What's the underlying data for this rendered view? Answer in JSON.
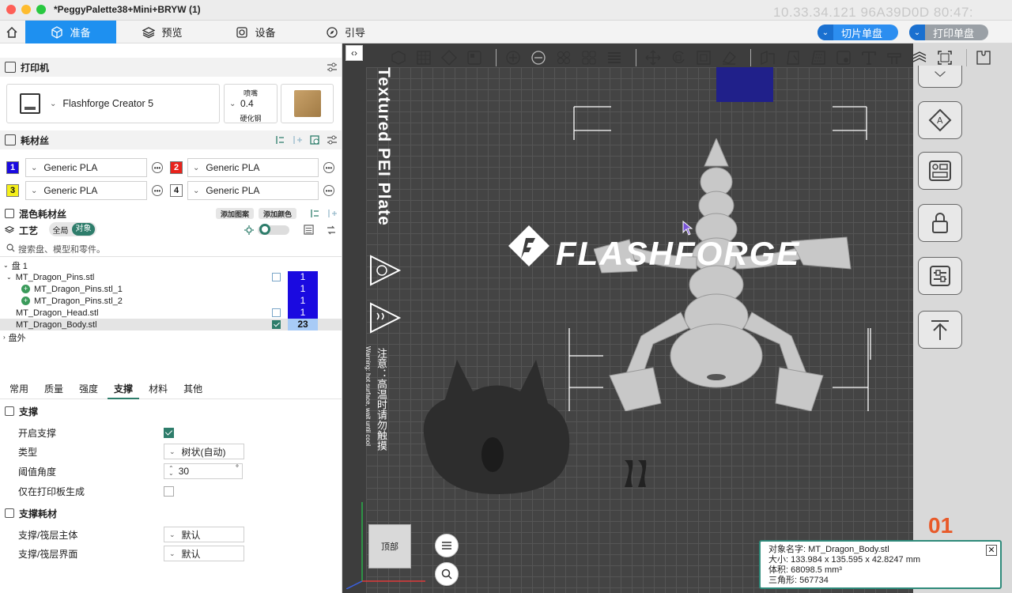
{
  "window": {
    "title": "*PeggyPalette38+Mini+BRYW (1)",
    "ip_watermark": "10.33.34.121  96A39D0D  80:47:"
  },
  "tabs": [
    {
      "label": "准备",
      "icon": "cube-icon",
      "active": true
    },
    {
      "label": "预览",
      "icon": "layers-icon",
      "active": false
    },
    {
      "label": "设备",
      "icon": "device-icon",
      "active": false
    },
    {
      "label": "引导",
      "icon": "compass-icon",
      "active": false
    }
  ],
  "actions": {
    "slice_label": "切片单盘",
    "print_label": "打印单盘"
  },
  "printer": {
    "section_title": "打印机",
    "name": "Flashforge Creator 5",
    "nozzle_label": "喷嘴",
    "nozzle_value": "0.4",
    "nozzle_material": "硬化钢"
  },
  "filament": {
    "section_title": "耗材丝",
    "slots": [
      {
        "index": "1",
        "name": "Generic PLA",
        "color": "#1a0ae0",
        "text_color": "#ffffff"
      },
      {
        "index": "2",
        "name": "Generic PLA",
        "color": "#e8231c",
        "text_color": "#ffffff"
      },
      {
        "index": "3",
        "name": "Generic PLA",
        "color": "#f5f01a",
        "text_color": "#111111"
      },
      {
        "index": "4",
        "name": "Generic PLA",
        "color": "#ffffff",
        "text_color": "#111111"
      }
    ]
  },
  "mixed": {
    "title": "混色耗材丝",
    "add_pattern": "添加图案",
    "add_color": "添加颜色"
  },
  "process": {
    "title": "工艺",
    "toggle_global": "全局",
    "toggle_object": "对象"
  },
  "search": {
    "placeholder": "搜索盘、模型和零件。"
  },
  "tree": {
    "plate": "盘 1",
    "items": [
      {
        "name": "MT_Dragon_Pins.stl",
        "index": "1"
      },
      {
        "name": "MT_Dragon_Pins.stl_1",
        "index": "1"
      },
      {
        "name": "MT_Dragon_Pins.stl_2",
        "index": "1"
      },
      {
        "name": "MT_Dragon_Head.stl",
        "index": "1"
      },
      {
        "name": "MT_Dragon_Body.stl",
        "index": "23"
      }
    ],
    "outside": "盘外"
  },
  "prop_tabs": [
    "常用",
    "质量",
    "强度",
    "支撑",
    "材料",
    "其他"
  ],
  "support": {
    "heading": "支撑",
    "enable_label": "开启支撑",
    "type_label": "类型",
    "type_value": "树状(自动)",
    "threshold_label": "阈值角度",
    "threshold_value": "30",
    "threshold_unit": "°",
    "buildplate_only_label": "仅在打印板生成",
    "filament_heading": "支撑耗材",
    "base_label": "支撑/筏层主体",
    "base_value": "默认",
    "interface_label": "支撑/筏层界面",
    "interface_value": "默认"
  },
  "viewport": {
    "plate_label": "Textured PEI Plate",
    "brand": "FLASHFORGE",
    "warning": "注意：高温时请勿触摸",
    "warning_en": "Warning: hot surface, wait until cool",
    "view_cube_label": "顶部",
    "plate_number": "01"
  },
  "object_info": {
    "name_label": "对象名字:",
    "name_value": "MT_Dragon_Body.stl",
    "size_label": "大小:",
    "size_value": "133.984 x 135.595 x 42.8247 mm",
    "volume_label": "体积:",
    "volume_value": "68098.5 mm³",
    "triangles_label": "三角形:",
    "triangles_value": "567734"
  },
  "colors": {
    "accent": "#1e90f0",
    "teal": "#2e7d6b",
    "plate_dark": "#444444"
  }
}
